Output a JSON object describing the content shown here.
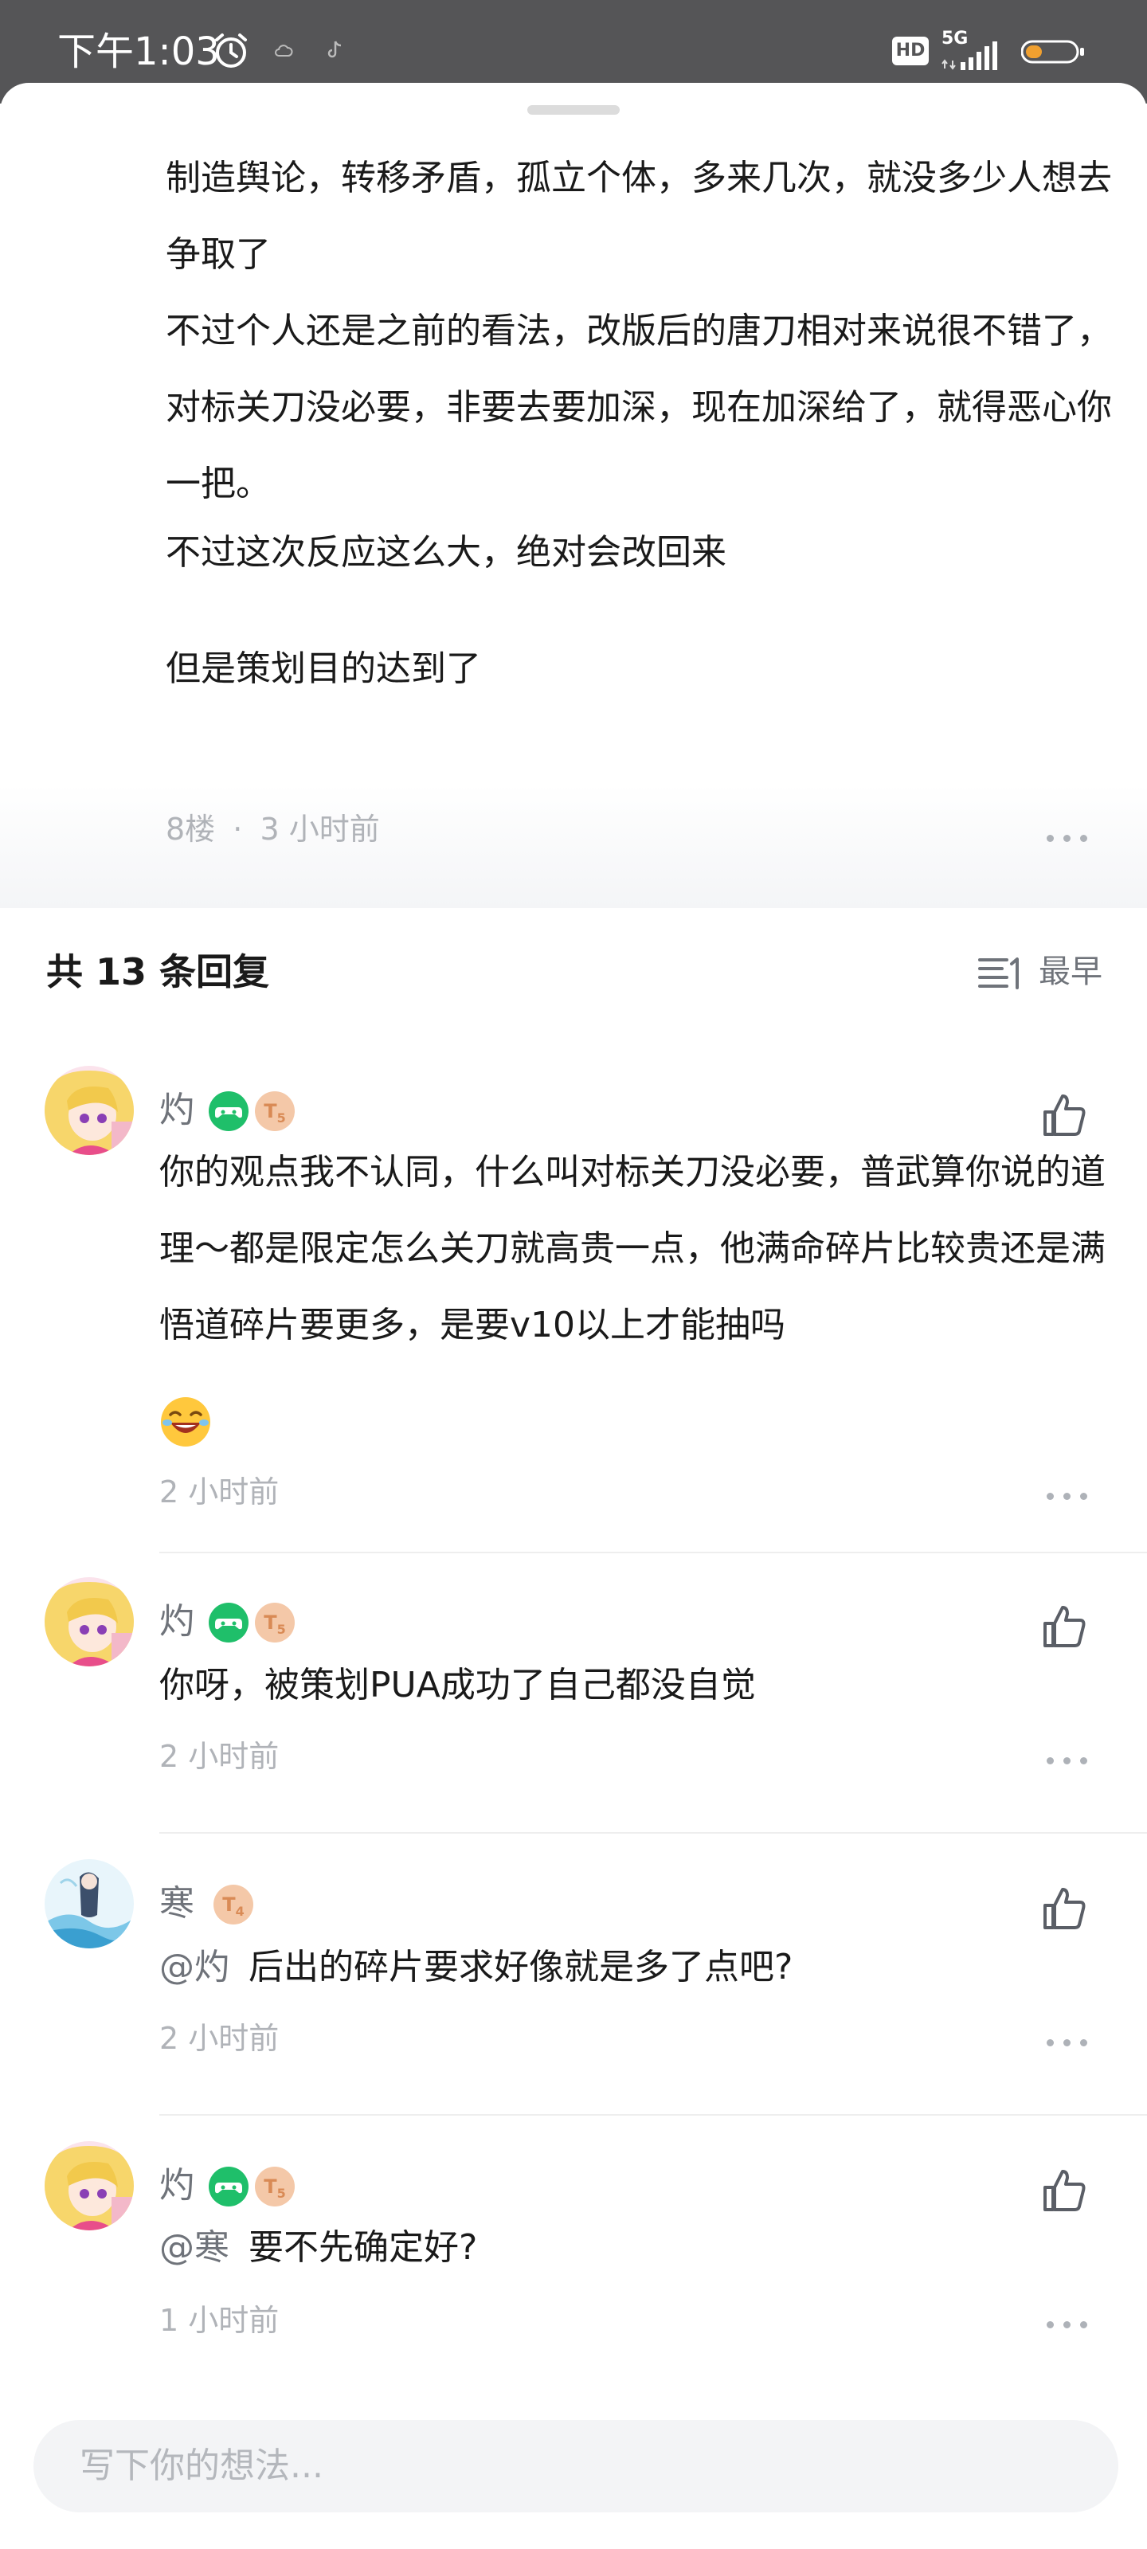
{
  "status_bar": {
    "time": "下午1:03",
    "hd_label": "HD",
    "network": "5G"
  },
  "post": {
    "paragraphs": [
      "制造舆论，转移矛盾，孤立个体，多来几次，就没多少人想去争取了",
      "不过个人还是之前的看法，改版后的唐刀相对来说很不错了，对标关刀没必要，非要去要加深，现在加深给了，就得恶心你一把。",
      "不过这次反应这么大，绝对会改回来",
      "但是策划目的达到了"
    ],
    "floor": "8楼",
    "separator": "·",
    "time": "3 小时前"
  },
  "replies": {
    "count_label": "共 13 条回复",
    "sort_label": "最早"
  },
  "comments": [
    {
      "user": "灼",
      "level": "5",
      "text": "你的观点我不认同，什么叫对标关刀没必要，普武算你说的道理～都是限定怎么关刀就高贵一点，他满命碎片比较贵还是满悟道碎片要更多，是要v10以上才能抽吗",
      "emoji": "laughing-emoji",
      "time": "2 小时前"
    },
    {
      "user": "灼",
      "level": "5",
      "text": "你呀，被策划PUA成功了自己都没自觉",
      "time": "2 小时前"
    },
    {
      "user": "寒",
      "level": "4",
      "mention": "@灼",
      "text": "后出的碎片要求好像就是多了点吧?",
      "time": "2 小时前"
    },
    {
      "user": "灼",
      "level": "5",
      "mention": "@寒",
      "text": "要不先确定好?",
      "time": "1 小时前"
    }
  ],
  "input": {
    "placeholder": "写下你的想法..."
  },
  "colors": {
    "status_bar_bg": "#555557",
    "game_badge": "#1fbf6a",
    "level_badge": "#f4c8a8",
    "secondary_text": "#6f737a",
    "muted_text": "#b0b3b8"
  }
}
